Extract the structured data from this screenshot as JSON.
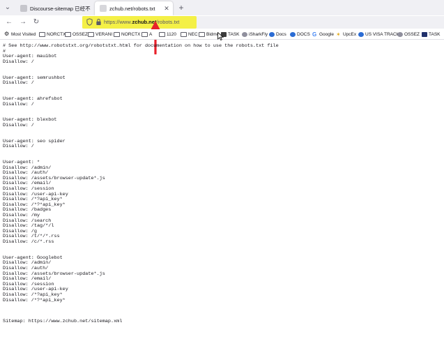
{
  "tabs": [
    {
      "title": "Discourse-sitemap 已经不需要了",
      "active": false
    },
    {
      "title": "zchub.net/robots.txt",
      "active": true
    }
  ],
  "address_bar": {
    "prefix": "https://www.",
    "domain": "zchub.net",
    "path": "/robots.txt"
  },
  "bookmarks": [
    {
      "label": "Most Visited",
      "icon": "gear-icon"
    },
    {
      "label": "NORCTX",
      "icon": "folder-icon"
    },
    {
      "label": "OSSEZ",
      "icon": "folder-icon"
    },
    {
      "label": "VERANI",
      "icon": "folder-icon"
    },
    {
      "label": "NORCTX",
      "icon": "folder-icon"
    },
    {
      "label": "A",
      "icon": "folder-icon"
    },
    {
      "label": "1120",
      "icon": "folder-icon"
    },
    {
      "label": "NEC",
      "icon": "folder-icon"
    },
    {
      "label": "Bidmc",
      "icon": "folder-icon"
    },
    {
      "label": "TASK",
      "icon": "task-icon"
    },
    {
      "label": "iSharkFly",
      "icon": "isharkfly-icon"
    },
    {
      "label": "Docs",
      "icon": "docs-icon"
    },
    {
      "label": "DOCS",
      "icon": "docs-icon"
    },
    {
      "label": "Google",
      "icon": "google-icon"
    },
    {
      "label": "UpcEx",
      "icon": "ups-icon"
    },
    {
      "label": "US VISA TRACK",
      "icon": "visa-icon"
    },
    {
      "label": "OSSEZ",
      "icon": "ossez-icon"
    },
    {
      "label": "TASK",
      "icon": "task-icon"
    }
  ],
  "robots_txt": "# See http://www.robotstxt.org/robotstxt.html for documentation on how to use the robots.txt file\n#\nUser-agent: mauibot\nDisallow: /\n\n\nUser-agent: semrushbot\nDisallow: /\n\n\nUser-agent: ahrefsbot\nDisallow: /\n\n\nUser-agent: blexbot\nDisallow: /\n\n\nUser-agent: seo spider\nDisallow: /\n\n\nUser-agent: *\nDisallow: /admin/\nDisallow: /auth/\nDisallow: /assets/browser-update*.js\nDisallow: /email/\nDisallow: /session\nDisallow: /user-api-key\nDisallow: /*?api_key*\nDisallow: /*?*api_key*\nDisallow: /badges\nDisallow: /my\nDisallow: /search\nDisallow: /tag/*/l\nDisallow: /g\nDisallow: /t/*/*.rss\nDisallow: /c/*.rss\n\n\nUser-agent: Googlebot\nDisallow: /admin/\nDisallow: /auth/\nDisallow: /assets/browser-update*.js\nDisallow: /email/\nDisallow: /session\nDisallow: /user-api-key\nDisallow: /*?api_key*\nDisallow: /*?*api_key*\n\n\n\nSitemap: https://www.zchub.net/sitemap.xml",
  "colors": {
    "url_highlight": "#f4f046",
    "annotation_arrow": "#e8212b"
  }
}
